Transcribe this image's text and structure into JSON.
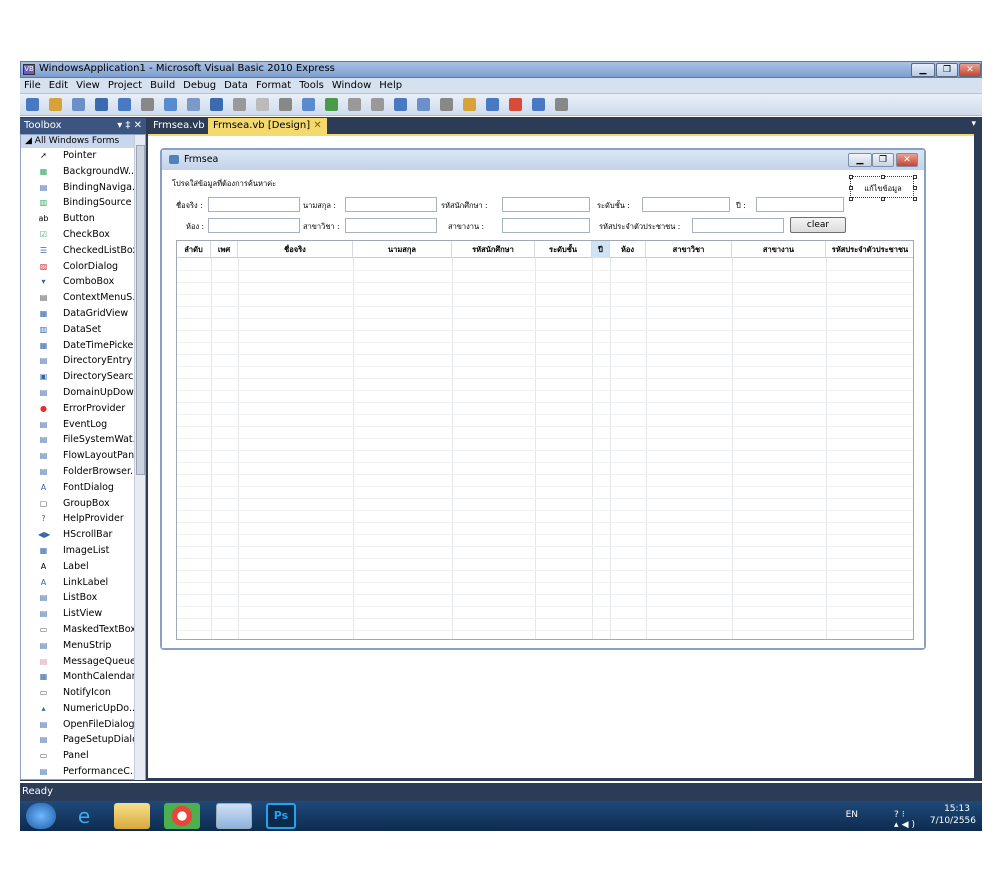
{
  "window": {
    "title": "WindowsApplication1 - Microsoft Visual Basic 2010 Express"
  },
  "menu": [
    "File",
    "Edit",
    "View",
    "Project",
    "Build",
    "Debug",
    "Data",
    "Format",
    "Tools",
    "Window",
    "Help"
  ],
  "toolbox": {
    "title": "Toolbox",
    "pin": "▾ ‡ ✕",
    "group": "◢ All Windows Forms",
    "items": [
      "Pointer",
      "BackgroundW...",
      "BindingNaviga...",
      "BindingSource",
      "Button",
      "CheckBox",
      "CheckedListBox",
      "ColorDialog",
      "ComboBox",
      "ContextMenuS...",
      "DataGridView",
      "DataSet",
      "DateTimePicker",
      "DirectoryEntry",
      "DirectorySearc...",
      "DomainUpDown",
      "ErrorProvider",
      "EventLog",
      "FileSystemWat...",
      "FlowLayoutPanel",
      "FolderBrowser...",
      "FontDialog",
      "GroupBox",
      "HelpProvider",
      "HScrollBar",
      "ImageList",
      "Label",
      "LinkLabel",
      "ListBox",
      "ListView",
      "MaskedTextBox",
      "MenuStrip",
      "MessageQueue",
      "MonthCalendar",
      "NotifyIcon",
      "NumericUpDo...",
      "OpenFileDialog",
      "PageSetupDialog",
      "Panel",
      "PerformanceC..."
    ]
  },
  "tabs": [
    {
      "label": "Frmsea.vb"
    },
    {
      "label": "Frmsea.vb [Design]",
      "close": "✕"
    }
  ],
  "form": {
    "title": "Frmsea",
    "instruction": "โปรดใส่ข้อมูลที่ต้องการค้นหาค่ะ",
    "labels": {
      "name": "ชื่อจริง :",
      "surname": "นามสกุล :",
      "student_id": "รหัสนักศึกษา :",
      "level": "ระดับชั้น :",
      "year": "ปี :",
      "room": "ห้อง :",
      "major": "สาขาวิชา :",
      "dept": "สาขางาน :",
      "citizen_id": "รหัสประจำตัวประชาชน :"
    },
    "clear": "clear",
    "edit": "แก้ไขข้อมูล",
    "columns": [
      "ลำดับ",
      "เพศ",
      "ชื่อจริง",
      "นามสกุล",
      "รหัสนักศึกษา",
      "ระดับชั้น",
      "ปี",
      "ห้อง",
      "สาขาวิชา",
      "สาขางาน",
      "รหัสประจำตัวประชาชน"
    ]
  },
  "status": "Ready",
  "taskbar": {
    "lang": "EN",
    "time": "15:13",
    "date": "7/10/2556"
  },
  "colors": {
    "accent": "#2c3b56",
    "tab_active": "#f4d96e"
  }
}
